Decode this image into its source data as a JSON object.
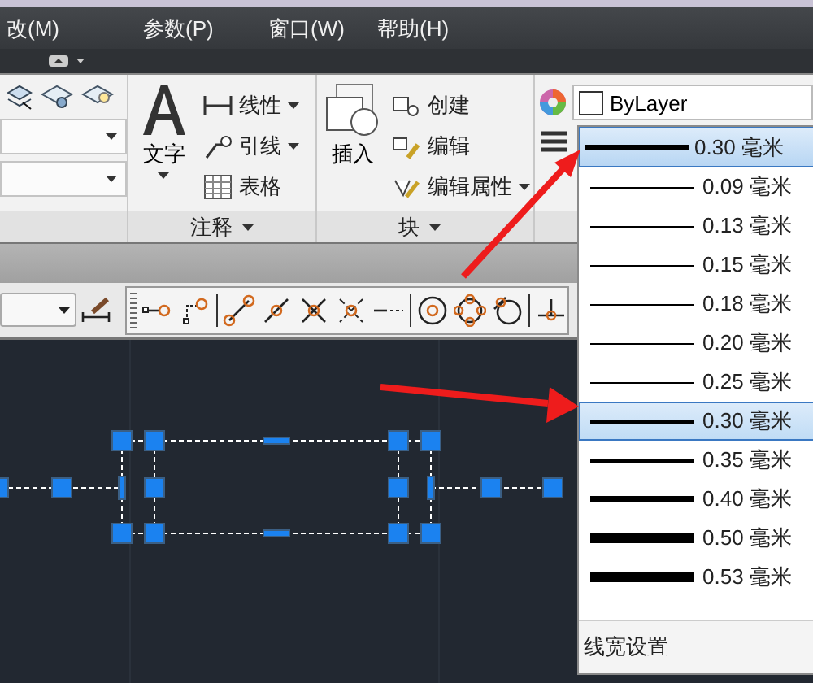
{
  "menu": [
    {
      "label": "改(M)"
    },
    {
      "label": "参数(P)"
    },
    {
      "label": "窗口(W)"
    },
    {
      "label": "帮助(H)"
    }
  ],
  "annotation_panel": {
    "big_tool": "文字",
    "tools": [
      {
        "label": "线性",
        "has_menu": true
      },
      {
        "label": "引线",
        "has_menu": true
      },
      {
        "label": "表格",
        "has_menu": false
      }
    ],
    "title": "注释"
  },
  "block_panel": {
    "big_tool": "插入",
    "tools": [
      {
        "label": "创建",
        "has_menu": false
      },
      {
        "label": "编辑",
        "has_menu": false
      },
      {
        "label": "编辑属性",
        "has_menu": true
      }
    ],
    "title": "块"
  },
  "properties_panel": {
    "color_value": "ByLayer"
  },
  "lineweight_dropdown": {
    "current": {
      "label": "0.30 毫米",
      "kind": "medium"
    },
    "items": [
      {
        "label": "0.09 毫米",
        "kind": "thin",
        "selected": false
      },
      {
        "label": "0.13 毫米",
        "kind": "thin",
        "selected": false
      },
      {
        "label": "0.15 毫米",
        "kind": "thin",
        "selected": false
      },
      {
        "label": "0.18 毫米",
        "kind": "thin",
        "selected": false
      },
      {
        "label": "0.20 毫米",
        "kind": "thin",
        "selected": false
      },
      {
        "label": "0.25 毫米",
        "kind": "thin",
        "selected": false
      },
      {
        "label": "0.30 毫米",
        "kind": "medium",
        "selected": true
      },
      {
        "label": "0.35 毫米",
        "kind": "medium",
        "selected": false
      },
      {
        "label": "0.40 毫米",
        "kind": "thick",
        "selected": false
      },
      {
        "label": "0.50 毫米",
        "kind": "heavy",
        "selected": false
      },
      {
        "label": "0.53 毫米",
        "kind": "heavy",
        "selected": false
      }
    ],
    "footer": "线宽设置"
  }
}
